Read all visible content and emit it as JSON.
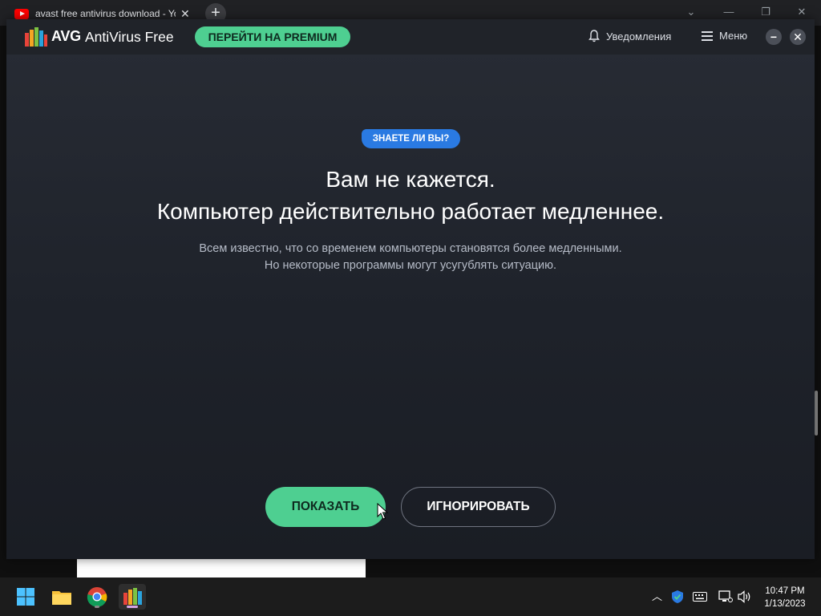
{
  "browser": {
    "tab_title": "avast free antivirus download - YouTube",
    "tab_close": "✕",
    "new_tab": "+",
    "win_minimize": "—",
    "win_restore": "❐",
    "win_close": "✕",
    "win_chevron": "⌄"
  },
  "avg": {
    "brand": "AVG",
    "product": "AntiVirus Free",
    "premium_button": "ПЕРЕЙТИ НА PREMIUM",
    "notifications_label": "Уведомления",
    "menu_label": "Меню",
    "minimize": "−",
    "close": "✕",
    "badge": "ЗНАЕТЕ ЛИ ВЫ?",
    "headline_line1": "Вам не кажется.",
    "headline_line2": "Компьютер действительно работает медленнее.",
    "subtext_line1": "Всем известно, что со временем компьютеры становятся более медленными.",
    "subtext_line2": "Но некоторые программы могут усугублять ситуацию.",
    "show_button": "ПОКАЗАТЬ",
    "ignore_button": "ИГНОРИРОВАТЬ",
    "colors": {
      "accent_green": "#4ecf91",
      "badge_blue": "#2a7ae2"
    }
  },
  "taskbar": {
    "icons": [
      "windows-start-icon",
      "file-explorer-icon",
      "chrome-icon",
      "avg-icon"
    ],
    "tray_chevron": "︿",
    "time": "10:47 PM",
    "date": "1/13/2023"
  }
}
